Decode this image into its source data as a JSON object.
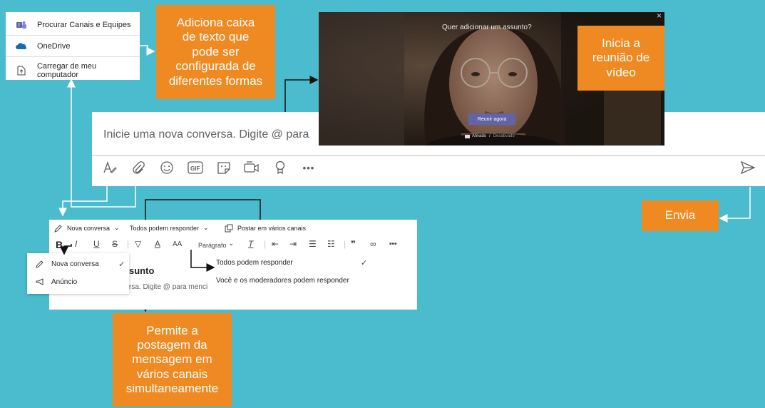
{
  "attach_menu": {
    "items": [
      {
        "label": "Procurar Canais e Equipes",
        "icon": "teams-icon"
      },
      {
        "label": "OneDrive",
        "icon": "onedrive-icon"
      },
      {
        "label": "Carregar de meu computador",
        "icon": "upload-file-icon"
      }
    ]
  },
  "compose": {
    "placeholder": "Inicie uma nova conversa. Digite @ para"
  },
  "toolbar_icons": [
    "format-icon",
    "attach-icon",
    "emoji-icon",
    "gif-icon",
    "sticker-icon",
    "meet-now-icon",
    "praise-icon",
    "more-icon",
    "send-icon"
  ],
  "gif_label": "GIF",
  "more_label": "•••",
  "video": {
    "subject_placeholder": "Quer adicionar um assunto?",
    "start_button": "Reunir agora",
    "close": "×",
    "camera_on": "Ativado",
    "camera_separator": "/",
    "camera_off": "Desativado"
  },
  "format_panel": {
    "post_type": "Nova conversa",
    "reply_setting": "Todos podem responder",
    "multi_channel": "Postar em vários canais",
    "paragraph": "Parágrafo",
    "subject_partial": "sunto",
    "body_partial": "rsa. Digite @ para menci",
    "format_buttons": [
      "B",
      "I",
      "U",
      "S",
      "A",
      "AA"
    ]
  },
  "post_type_menu": {
    "items": [
      {
        "label": "Nova conversa",
        "icon": "edit-icon",
        "checked": true
      },
      {
        "label": "Anúncio",
        "icon": "megaphone-icon",
        "checked": false
      }
    ]
  },
  "reply_menu": {
    "items": [
      {
        "label": "Todos podem responder",
        "checked": true
      },
      {
        "label": "Você e os moderadores podem responder",
        "checked": false
      }
    ]
  },
  "callouts": {
    "textbox": "Adiciona caixa\nde texto que\npode ser\nconfigurada de\ndiferentes formas",
    "video": "Inicia a\nreunião de\nvídeo",
    "send": "Envia",
    "multi": "Permite a\npostagem da\nmensagem em\nvários canais\nsimultaneamente"
  },
  "colors": {
    "background": "#4bbccd",
    "callout": "#ef8a22",
    "teams_purple": "#6264a7"
  }
}
